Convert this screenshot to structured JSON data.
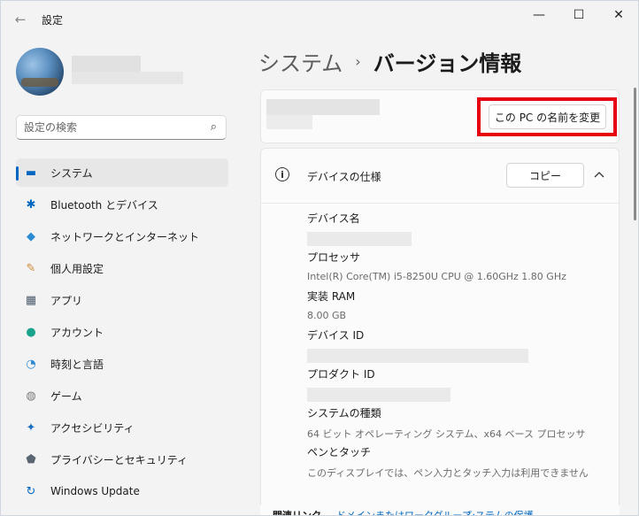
{
  "window": {
    "title": "設定",
    "back_glyph": "←",
    "controls": {
      "minimize": "—",
      "maximize": "☐",
      "close": "✕"
    }
  },
  "sidebar": {
    "search": {
      "placeholder": "設定の検索",
      "value": "",
      "icon": "search-icon"
    },
    "items": [
      {
        "label": "システム",
        "icon": "monitor-icon",
        "glyph": "▬",
        "color": "#0067c0",
        "selected": true
      },
      {
        "label": "Bluetooth とデバイス",
        "icon": "bluetooth-icon",
        "glyph": "✱",
        "color": "#0067c0"
      },
      {
        "label": "ネットワークとインターネット",
        "icon": "wifi-icon",
        "glyph": "◆",
        "color": "#2a8ad4"
      },
      {
        "label": "個人用設定",
        "icon": "brush-icon",
        "glyph": "✎",
        "color": "#d08a3a"
      },
      {
        "label": "アプリ",
        "icon": "apps-icon",
        "glyph": "▦",
        "color": "#4b5a6b"
      },
      {
        "label": "アカウント",
        "icon": "person-icon",
        "glyph": "●",
        "color": "#1aa38c"
      },
      {
        "label": "時刻と言語",
        "icon": "globe-clock-icon",
        "glyph": "◔",
        "color": "#2a8ad4"
      },
      {
        "label": "ゲーム",
        "icon": "gamepad-icon",
        "glyph": "◍",
        "color": "#7a7a7a"
      },
      {
        "label": "アクセシビリティ",
        "icon": "accessibility-icon",
        "glyph": "✦",
        "color": "#1f6fbf"
      },
      {
        "label": "プライバシーとセキュリティ",
        "icon": "shield-icon",
        "glyph": "⬟",
        "color": "#5a6572"
      },
      {
        "label": "Windows Update",
        "icon": "update-icon",
        "glyph": "↻",
        "color": "#0067c0"
      }
    ]
  },
  "main": {
    "breadcrumb": {
      "parent": "システム",
      "separator": "›",
      "current": "バージョン情報"
    },
    "rename_button": "この PC の名前を変更",
    "spec_section": {
      "title": "デバイスの仕様",
      "copy_button": "コピー",
      "expander_glyph": "^",
      "rows": [
        {
          "label": "デバイス名",
          "value": ""
        },
        {
          "label": "プロセッサ",
          "value": "Intel(R) Core(TM) i5-8250U CPU @ 1.60GHz   1.80 GHz"
        },
        {
          "label": "実装 RAM",
          "value": "8.00 GB"
        },
        {
          "label": "デバイス ID",
          "value": ""
        },
        {
          "label": "プロダクト ID",
          "value": ""
        },
        {
          "label": "システムの種類",
          "value": "64 ビット オペレーティング システム、x64 ベース プロセッサ"
        },
        {
          "label": "ペンとタッチ",
          "value": "このディスプレイでは、ペン入力とタッチ入力は利用できません"
        }
      ]
    },
    "related_links": {
      "title": "関連リンク",
      "links": [
        "ドメインまたはワークグループ",
        "システムの保護"
      ]
    }
  },
  "colors": {
    "accent": "#0067c0",
    "highlight_box": "#e60012"
  }
}
